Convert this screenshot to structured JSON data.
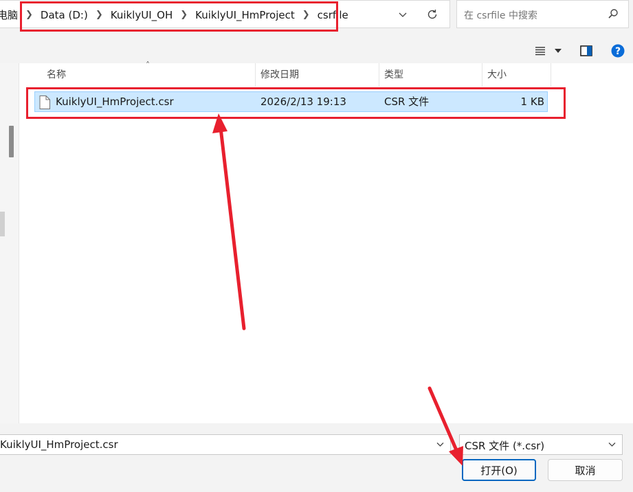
{
  "address_bar": {
    "crumbs": [
      "电脑",
      "Data (D:)",
      "KuiklyUI_OH",
      "KuiklyUI_HmProject",
      "csrfile"
    ],
    "icons": [
      "chevron-down-icon",
      "refresh-icon"
    ]
  },
  "search": {
    "placeholder": "在 csrfile 中搜索",
    "icon": "search-icon"
  },
  "command_bar": {
    "icons": [
      "view-list-icon",
      "chevron-down-icon",
      "preview-pane-icon",
      "help-icon"
    ]
  },
  "file_list": {
    "columns": [
      "名称",
      "修改日期",
      "类型",
      "大小"
    ],
    "rows": [
      {
        "name": "KuiklyUI_HmProject.csr",
        "modified": "2026/2/13 19:13",
        "type": "CSR 文件",
        "size": "1 KB",
        "selected": true
      }
    ]
  },
  "bottom": {
    "filename_value": "KuiklyUI_HmProject.csr",
    "filetype_value": "CSR 文件 (*.csr)",
    "open_label": "打开(O)",
    "cancel_label": "取消"
  },
  "annotations": {
    "highlight_color": "#e8202e",
    "accent": "#0067c0",
    "selection_bg": "#cce8ff"
  }
}
